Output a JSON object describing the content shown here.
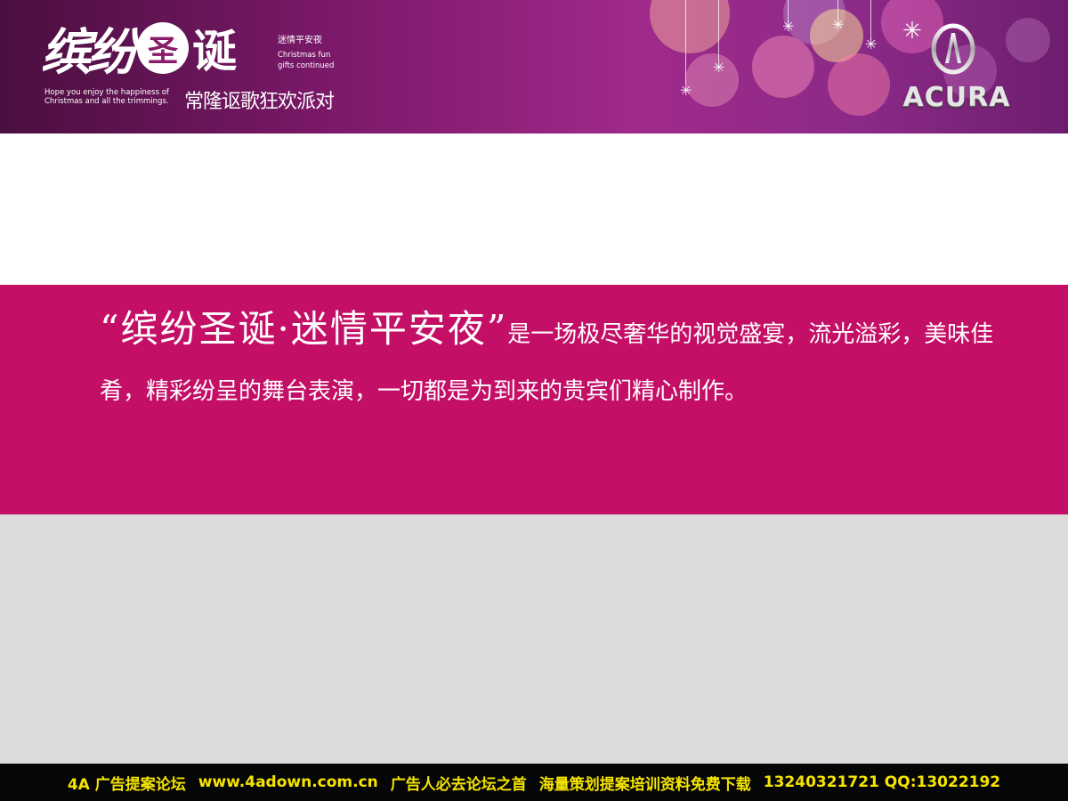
{
  "header": {
    "title_script": "缤纷",
    "title_circle": "圣",
    "title_bold": "诞",
    "side_cn": "迷情平安夜",
    "side_en": "Christmas fun gifts continued",
    "hope_en": "Hope you enjoy the happiness of Christmas and all the trimmings.",
    "party_cn": "常隆讴歌狂欢派对",
    "brand": "ACURA",
    "brand_icon": "acura-emblem-icon",
    "decoration_icon": "snowflake-icon",
    "colors": {
      "banner": "#7a1868",
      "accent": "#c40f66"
    }
  },
  "body": {
    "lead": "“缤纷圣诞·迷情平安夜”",
    "text": "是一场极尽奢华的视觉盛宴，流光溢彩，美味佳肴，精彩纷呈的舞台表演，一切都是为到来的贵宾们精心制作。"
  },
  "footer": {
    "forum": "4A 广告提案论坛",
    "url": "www.4adown.com.cn",
    "slogan": "广告人必去论坛之首",
    "desc": "海量策划提案培训资料免费下载",
    "contact": "13240321721 QQ:13022192"
  }
}
